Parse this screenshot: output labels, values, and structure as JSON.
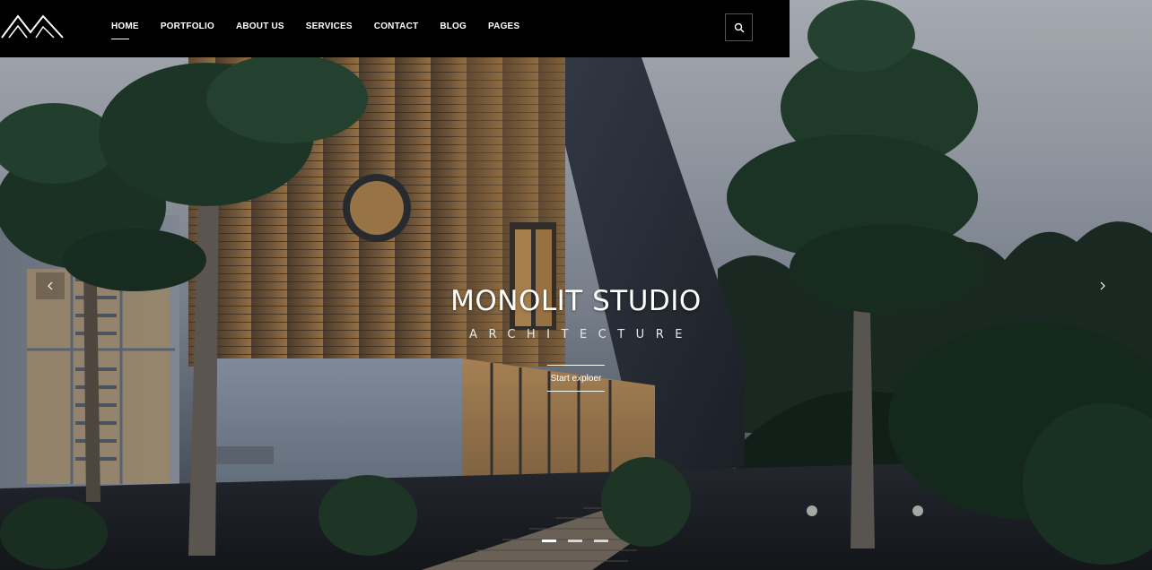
{
  "header": {
    "logo": {
      "icon": "mountain-logo-icon"
    },
    "nav": [
      {
        "label": "HOME",
        "active": true
      },
      {
        "label": "PORTFOLIO",
        "active": false
      },
      {
        "label": "ABOUT US",
        "active": false
      },
      {
        "label": "SERVICES",
        "active": false
      },
      {
        "label": "CONTACT",
        "active": false
      },
      {
        "label": "BLOG",
        "active": false
      },
      {
        "label": "PAGES",
        "active": false
      }
    ],
    "search": {
      "icon": "search-icon"
    }
  },
  "hero": {
    "title": "MONOLIT STUDIO",
    "subtitle": "ARCHITECTURE",
    "cta_label": "Start exploer",
    "prev_icon": "chevron-left-icon",
    "next_icon": "chevron-right-icon",
    "slides": {
      "count": 3,
      "active_index": 0
    },
    "background": "modern house with wood facade among pine trees at dusk"
  },
  "colors": {
    "header_bg": "#000000",
    "text": "#ffffff"
  }
}
